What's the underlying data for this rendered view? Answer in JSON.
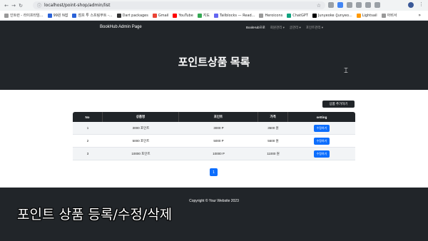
{
  "browser": {
    "url": "localhost/point-shop/admin/list",
    "bookmarks": [
      "인트런 - 라이프타임...",
      "99원 N잡",
      "점프 투 스프링부트 -...",
      "Dart packages",
      "Gmail",
      "YouTube",
      "지도",
      "Tailblocks — Read...",
      "Heroicons",
      "ChatGPT",
      "Junyeoke (Junyeo...",
      "Lightsail",
      "아비서"
    ],
    "more": "»"
  },
  "navbar": {
    "brand": "BookHub Admin Page",
    "links": [
      "BookHub으로",
      "회원관리 ▾",
      "글관리 ▾",
      "포인트관리 ▾"
    ]
  },
  "hero": {
    "title": "포인트상품 목록"
  },
  "toolbar": {
    "add_label": "상품 추가하기"
  },
  "table": {
    "headers": [
      "No",
      "상품명",
      "포인트",
      "가격",
      "setting"
    ],
    "rows": [
      {
        "no": "1",
        "name": "3000 포인트",
        "point": "3000 P",
        "price": "3500 원",
        "action": "수정하기"
      },
      {
        "no": "2",
        "name": "5000 포인트",
        "point": "5000 P",
        "price": "5500 원",
        "action": "수정하기"
      },
      {
        "no": "3",
        "name": "10000 포인트",
        "point": "10000 P",
        "price": "11000 원",
        "action": "수정하기"
      }
    ]
  },
  "pagination": {
    "current": "1"
  },
  "footer": {
    "text": "Copyright © Your Website 2023"
  },
  "caption": "포인트 상품 등록/수정/삭제"
}
